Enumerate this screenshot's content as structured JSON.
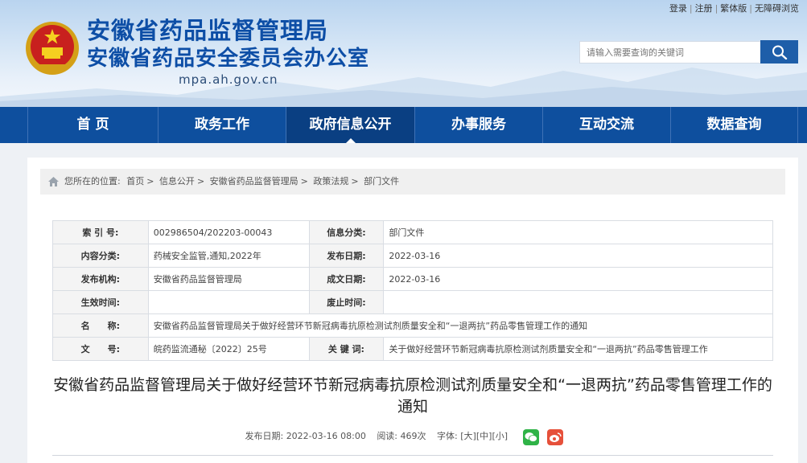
{
  "header": {
    "title_line1": "安徽省药品监督管理局",
    "title_line2": "安徽省药品安全委员会办公室",
    "domain": "mpa.ah.gov.cn"
  },
  "top_links": {
    "login": "登录",
    "register": "注册",
    "traditional": "繁体版",
    "accessible": "无障碍浏览",
    "separator": "|"
  },
  "search": {
    "placeholder": "请输入需要查询的关键词",
    "icon": "search-icon"
  },
  "nav": {
    "items": [
      {
        "label": "首 页"
      },
      {
        "label": "政务工作"
      },
      {
        "label": "政府信息公开"
      },
      {
        "label": "办事服务"
      },
      {
        "label": "互动交流"
      },
      {
        "label": "数据查询"
      }
    ],
    "active": "政府信息公开"
  },
  "breadcrumb": {
    "prefix": "您所在的位置:",
    "items": [
      "首页",
      "信息公开",
      "安徽省药品监督管理局",
      "政策法规",
      "部门文件"
    ],
    "separator": ">"
  },
  "info_table": {
    "index_label": "索 引 号:",
    "index_value": "002986504/202203-00043",
    "category_label": "信息分类:",
    "category_value": "部门文件",
    "topic_label": "内容分类:",
    "topic_value": "药械安全监管,通知,2022年",
    "publish_date_label": "发布日期:",
    "publish_date_value": "2022-03-16",
    "org_label": "发布机构:",
    "org_value": "安徽省药品监督管理局",
    "created_date_label": "成文日期:",
    "created_date_value": "2022-03-16",
    "effective_label": "生效时间:",
    "effective_value": "",
    "expire_label": "废止时间:",
    "expire_value": "",
    "name_label": "名　　称:",
    "name_value": "安徽省药品监督管理局关于做好经营环节新冠病毒抗原检测试剂质量安全和“一退两抗”药品零售管理工作的通知",
    "docno_label": "文　　号:",
    "docno_value": "皖药监流通秘〔2022〕25号",
    "keywords_label": "关 键 词:",
    "keywords_value": "关于做好经营环节新冠病毒抗原检测试剂质量安全和“一退两抗”药品零售管理工作"
  },
  "article": {
    "title": "安徽省药品监督管理局关于做好经营环节新冠病毒抗原检测试剂质量安全和“一退两抗”药品零售管理工作的通知",
    "publish_label": "发布日期:",
    "publish_time": "2022-03-16 08:00",
    "views_label": "阅读:",
    "views_value": "469次",
    "font_label": "字体:",
    "font_large": "[大]",
    "font_medium": "[中]",
    "font_small": "[小]"
  },
  "colors": {
    "nav_bg": "#0e4f9e",
    "nav_active": "#0a3f82",
    "title_blue": "#0d4ea6",
    "wechat": "#2fb347",
    "weibo": "#e6503a"
  }
}
